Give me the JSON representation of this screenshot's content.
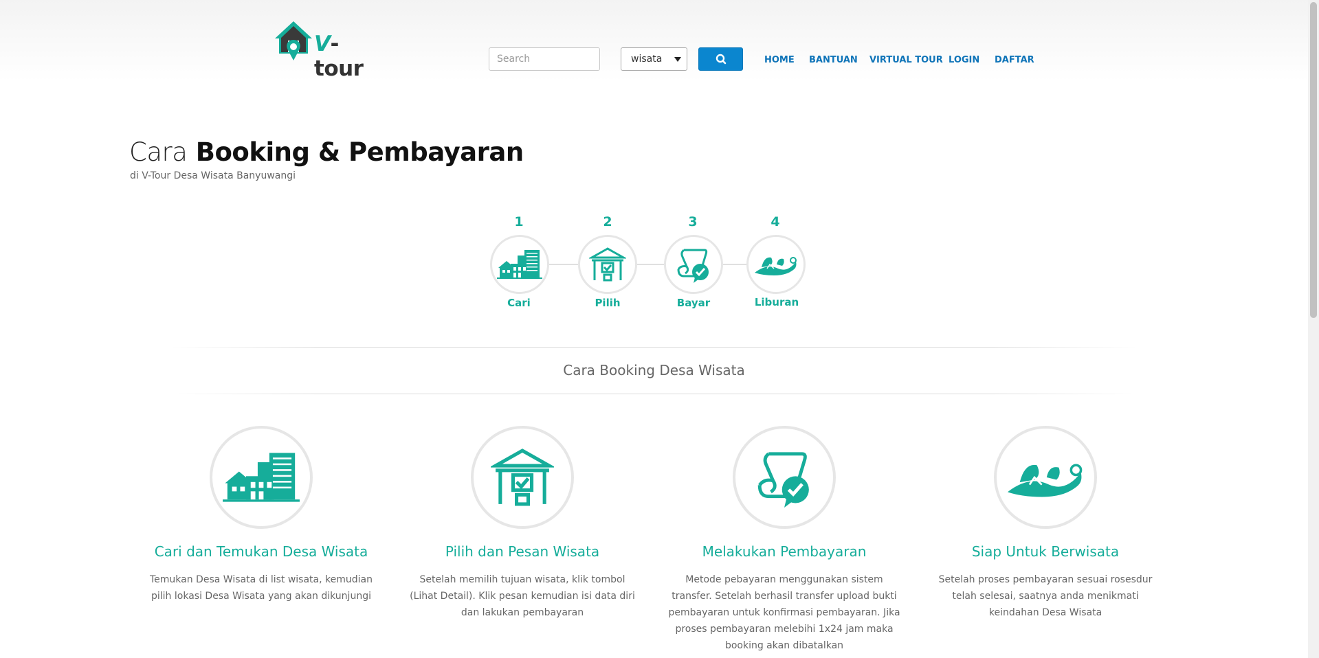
{
  "header": {
    "logo_text_v": "V",
    "logo_text_rest": "-tour",
    "search_placeholder": "Search",
    "category_selected": "wisata",
    "nav": [
      "HOME",
      "BANTUAN",
      "VIRTUAL TOUR",
      "LOGIN",
      "DAFTAR"
    ]
  },
  "hero": {
    "title_light": "Cara",
    "title_bold": "Booking & Pembayaran",
    "subtitle": "di V-Tour Desa Wisata Banyuwangi"
  },
  "steps": [
    {
      "num": "1",
      "label": "Cari",
      "icon": "buildings-icon"
    },
    {
      "num": "2",
      "label": "Pilih",
      "icon": "building-check-icon"
    },
    {
      "num": "3",
      "label": "Bayar",
      "icon": "scroll-check-icon"
    },
    {
      "num": "4",
      "label": "Liburan",
      "icon": "island-icon"
    }
  ],
  "section_title": "Cara Booking Desa Wisata",
  "cards": [
    {
      "title": "Cari dan Temukan Desa Wisata",
      "desc": "Temukan Desa Wisata di list wisata, kemudian pilih lokasi Desa Wisata yang akan dikunjungi",
      "icon": "buildings-icon"
    },
    {
      "title": "Pilih dan Pesan Wisata",
      "desc": "Setelah memilih tujuan wisata, klik tombol (Lihat Detail). Klik pesan kemudian isi data diri dan lakukan pembayaran",
      "icon": "building-check-icon"
    },
    {
      "title": "Melakukan Pembayaran",
      "desc": "Metode pebayaran menggunakan sistem transfer. Setelah berhasil transfer upload bukti pembayaran untuk konfirmasi pembayaran. Jika proses pembayaran melebihi 1x24 jam maka booking akan dibatalkan",
      "icon": "scroll-check-icon"
    },
    {
      "title": "Siap Untuk Berwisata",
      "desc": "Setelah proses pembayaran sesuai rosesdur telah selesai, saatnya anda menikmati keindahan Desa Wisata",
      "icon": "island-icon"
    }
  ],
  "colors": {
    "accent": "#16ad9a",
    "nav": "#0f74b8",
    "button": "#0b86cf"
  }
}
